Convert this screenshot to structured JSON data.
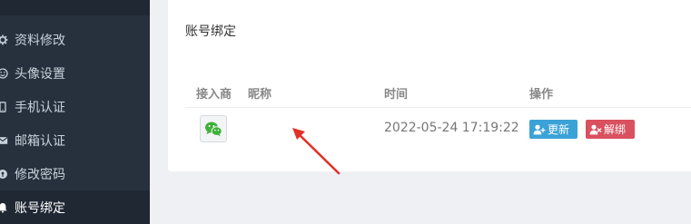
{
  "sidebar": {
    "items": [
      {
        "label": "资料修改",
        "icon": "gear-icon"
      },
      {
        "label": "头像设置",
        "icon": "smiley-icon"
      },
      {
        "label": "手机认证",
        "icon": "phone-icon"
      },
      {
        "label": "邮箱认证",
        "icon": "envelope-icon"
      },
      {
        "label": "修改密码",
        "icon": "key-icon"
      },
      {
        "label": "账号绑定",
        "icon": "bell-icon",
        "active": true
      }
    ]
  },
  "card": {
    "title": "账号绑定",
    "table": {
      "headers": [
        "接入商",
        "昵称",
        "时间",
        "操作"
      ],
      "rows": [
        {
          "provider_icon": "wechat-icon",
          "nickname": "",
          "time": "2022-05-24 17:19:22",
          "actions": {
            "update": "更新",
            "unbind": "解绑"
          }
        }
      ]
    }
  },
  "colors": {
    "sidebar_bg": "#27313d",
    "update_button": "#3ba2d7",
    "unbind_button": "#d9505f",
    "wechat_green": "#3fb13a",
    "arrow": "#e23128"
  }
}
